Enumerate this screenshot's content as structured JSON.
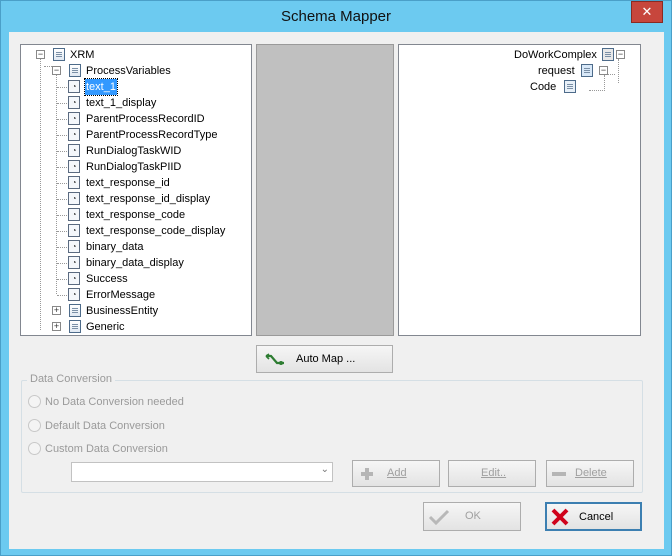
{
  "window": {
    "title": "Schema Mapper",
    "close_glyph": "✕"
  },
  "left_tree": {
    "root": "XRM",
    "process_variables": "ProcessVariables",
    "variables": [
      "text_1",
      "text_1_display",
      "ParentProcessRecordID",
      "ParentProcessRecordType",
      "RunDialogTaskWID",
      "RunDialogTaskPIID",
      "text_response_id",
      "text_response_id_display",
      "text_response_code",
      "text_response_code_display",
      "binary_data",
      "binary_data_display",
      "Success",
      "ErrorMessage"
    ],
    "selected_variable": "text_1",
    "business_entity": "BusinessEntity",
    "generic": "Generic"
  },
  "right_tree": {
    "root": "DoWorkComplex",
    "request": "request",
    "code": "Code"
  },
  "automap": {
    "label": "Auto Map ..."
  },
  "data_conversion": {
    "legend": "Data Conversion",
    "options": [
      "No Data Conversion needed",
      "Default Data Conversion",
      "Custom Data Conversion"
    ],
    "combo_value": "",
    "add_label": "Add",
    "edit_label": "Edit..",
    "delete_label": "Delete"
  },
  "footer": {
    "ok_label": "OK",
    "cancel_label": "Cancel"
  }
}
